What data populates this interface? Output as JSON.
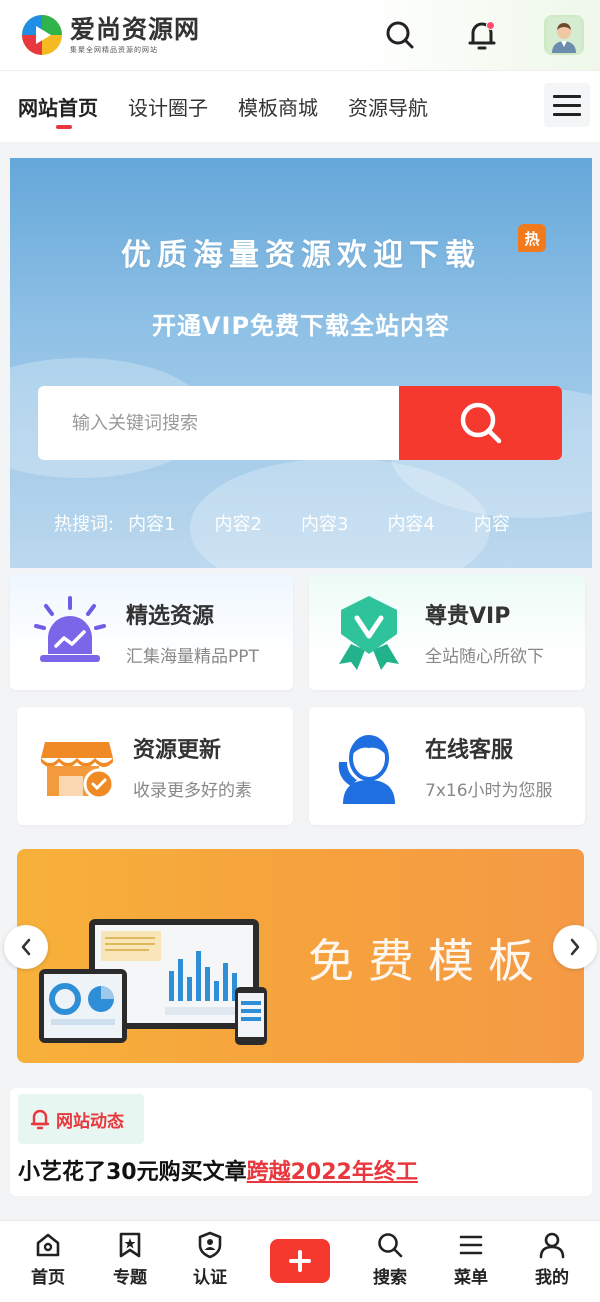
{
  "header": {
    "logo_title": "爱尚资源网",
    "logo_subtitle": "集聚全网精品资源的网站",
    "icons": [
      "search-icon",
      "bell-icon",
      "avatar"
    ]
  },
  "nav": {
    "items": [
      {
        "label": "网站首页",
        "active": true
      },
      {
        "label": "设计圈子",
        "active": false
      },
      {
        "label": "模板商城",
        "active": false
      },
      {
        "label": "资源导航",
        "active": false
      }
    ]
  },
  "hero": {
    "title": "优质海量资源欢迎下载",
    "hot_badge": "热",
    "subtitle": "开通VIP免费下载全站内容",
    "search_placeholder": "输入关键词搜索",
    "hotwords_label": "热搜词:",
    "hotwords": [
      "内容1",
      "内容2",
      "内容3",
      "内容4",
      "内容"
    ]
  },
  "cards": [
    {
      "title": "精选资源",
      "desc": "汇集海量精品PPT"
    },
    {
      "title": "尊贵VIP",
      "desc": "全站随心所欲下"
    },
    {
      "title": "资源更新",
      "desc": "收录更多好的素"
    },
    {
      "title": "在线客服",
      "desc": "7x16小时为您服"
    }
  ],
  "banner": {
    "text": "免费模板"
  },
  "news": {
    "tag": "网站动态",
    "text_prefix": "小艺花了30元购买文章",
    "text_highlight": "跨越2022年终工"
  },
  "tabbar": {
    "items": [
      {
        "label": "首页",
        "icon": "home-icon"
      },
      {
        "label": "专题",
        "icon": "bookmark-star-icon"
      },
      {
        "label": "认证",
        "icon": "shield-user-icon"
      },
      {
        "label": "",
        "icon": "plus-icon"
      },
      {
        "label": "搜索",
        "icon": "search-icon"
      },
      {
        "label": "菜单",
        "icon": "menu-icon"
      },
      {
        "label": "我的",
        "icon": "user-icon"
      }
    ]
  },
  "colors": {
    "accent_red": "#f5392e",
    "hero_blue": "#64a7d9",
    "banner_orange": "#f6a23d",
    "vip_green": "#2ec39b"
  }
}
